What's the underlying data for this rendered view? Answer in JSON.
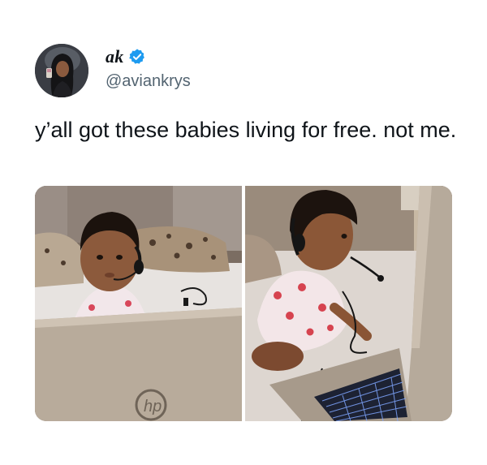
{
  "tweet": {
    "author": {
      "display_name": "ak",
      "handle": "@aviankrys",
      "verified": true,
      "verified_color": "#1d9bf0"
    },
    "text": "y’all got these babies living for free. not me.",
    "media": [
      {
        "name": "photo-baby-front",
        "laptop_logo": "hp"
      },
      {
        "name": "photo-baby-side"
      }
    ]
  }
}
